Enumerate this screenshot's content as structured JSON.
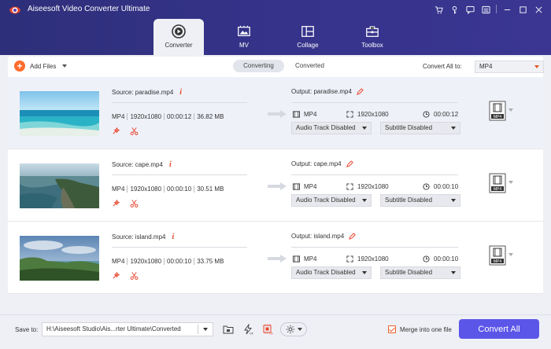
{
  "app": {
    "title": "Aiseesoft Video Converter Ultimate"
  },
  "nav": {
    "tabs": [
      {
        "label": "Converter",
        "icon": "converter-icon",
        "active": true
      },
      {
        "label": "MV",
        "icon": "mv-icon"
      },
      {
        "label": "Collage",
        "icon": "collage-icon"
      },
      {
        "label": "Toolbox",
        "icon": "toolbox-icon"
      }
    ]
  },
  "toolbar": {
    "add_files": "Add Files",
    "seg_converting": "Converting",
    "seg_converted": "Converted",
    "convert_all_label": "Convert All to:",
    "convert_all_value": "MP4"
  },
  "files": [
    {
      "source": "Source: paradise.mp4",
      "format": "MP4",
      "resolution": "1920x1080",
      "duration": "00:00:12",
      "size": "36.82 MB",
      "output": "Output: paradise.mp4",
      "out_format": "MP4",
      "out_resolution": "1920x1080",
      "out_duration": "00:00:12",
      "audio": "Audio Track Disabled",
      "subtitle": "Subtitle Disabled",
      "badge": "MP4"
    },
    {
      "source": "Source: cape.mp4",
      "format": "MP4",
      "resolution": "1920x1080",
      "duration": "00:00:10",
      "size": "30.51 MB",
      "output": "Output: cape.mp4",
      "out_format": "MP4",
      "out_resolution": "1920x1080",
      "out_duration": "00:00:10",
      "audio": "Audio Track Disabled",
      "subtitle": "Subtitle Disabled",
      "badge": "MP4"
    },
    {
      "source": "Source: island.mp4",
      "format": "MP4",
      "resolution": "1920x1080",
      "duration": "00:00:10",
      "size": "33.75 MB",
      "output": "Output: island.mp4",
      "out_format": "MP4",
      "out_resolution": "1920x1080",
      "out_duration": "00:00:10",
      "audio": "Audio Track Disabled",
      "subtitle": "Subtitle Disabled",
      "badge": "MP4"
    }
  ],
  "footer": {
    "save_label": "Save to:",
    "save_path": "H:\\Aiseesoft Studio\\Ais...rter Ultimate\\Converted",
    "merge_label": "Merge into one file",
    "convert_all": "Convert All"
  },
  "colors": {
    "accent": "#5b56e8",
    "title_bar": "#2e2f7a",
    "orange": "#ff6a2b",
    "red": "#e8452c"
  }
}
